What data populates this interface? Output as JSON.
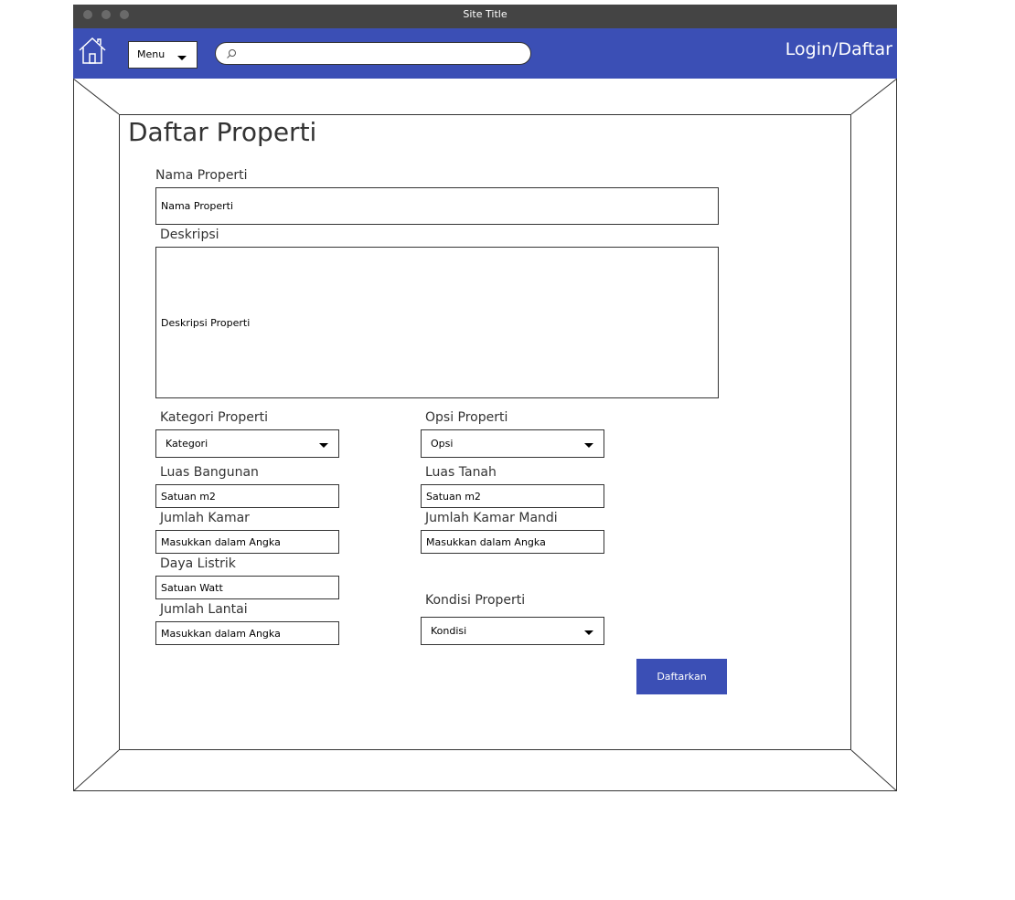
{
  "window": {
    "title": "Site Title"
  },
  "nav": {
    "menu_label": "Menu",
    "search_placeholder": "",
    "login_label": "Login/Daftar"
  },
  "page": {
    "title": "Daftar Properti"
  },
  "form": {
    "nama": {
      "label": "Nama Properti",
      "placeholder": "Nama Properti"
    },
    "deskripsi": {
      "label": "Deskripsi",
      "placeholder": "Deskripsi Properti"
    },
    "kategori": {
      "label": "Kategori Properti",
      "value": "Kategori"
    },
    "opsi": {
      "label": "Opsi Properti",
      "value": "Opsi"
    },
    "luas_bangunan": {
      "label": "Luas Bangunan",
      "placeholder": "Satuan m2"
    },
    "luas_tanah": {
      "label": "Luas Tanah",
      "placeholder": "Satuan m2"
    },
    "jumlah_kamar": {
      "label": "Jumlah Kamar",
      "placeholder": "Masukkan dalam Angka"
    },
    "jumlah_kamar_mandi": {
      "label": "Jumlah Kamar Mandi",
      "placeholder": "Masukkan dalam Angka"
    },
    "daya_listrik": {
      "label": "Daya Listrik",
      "placeholder": "Satuan Watt"
    },
    "jumlah_lantai": {
      "label": "Jumlah Lantai",
      "placeholder": "Masukkan dalam Angka"
    },
    "kondisi": {
      "label": "Kondisi Properti",
      "value": "Kondisi"
    },
    "submit_label": "Daftarkan"
  },
  "colors": {
    "navbar": "#3b4fb5",
    "titlebar": "#444444",
    "button": "#3b4fb5"
  },
  "icons": {
    "home": "home-icon",
    "search": "search-icon",
    "dropdown": "chevron-down-icon"
  }
}
